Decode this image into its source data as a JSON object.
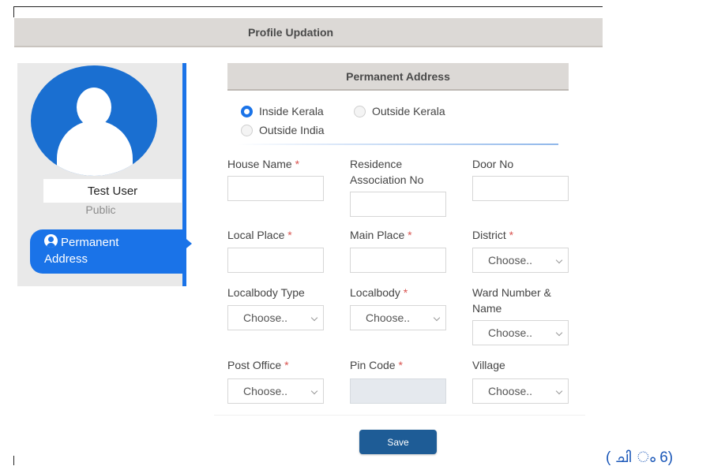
{
  "header": {
    "title": "Profile Updation"
  },
  "profile": {
    "name": "Test User",
    "role": "Public"
  },
  "sidebar": {
    "items": [
      {
        "label_line1": "Permanent",
        "label_line2": "Address"
      }
    ]
  },
  "section": {
    "title": "Permanent Address"
  },
  "location_options": [
    {
      "label": "Inside Kerala",
      "selected": true
    },
    {
      "label": "Outside Kerala",
      "selected": false
    },
    {
      "label": "Outside India",
      "selected": false
    }
  ],
  "fields": {
    "house_name": {
      "label": "House Name",
      "required_mark": "*"
    },
    "residence_assoc": {
      "label_line1": "Residence",
      "label_line2": "Association No"
    },
    "door_no": {
      "label": "Door No"
    },
    "local_place": {
      "label": "Local Place",
      "required_mark": "*"
    },
    "main_place": {
      "label": "Main Place",
      "required_mark": "*"
    },
    "district": {
      "label": "District",
      "required_mark": "*",
      "value": "Choose.."
    },
    "localbody_type": {
      "label": "Localbody Type",
      "value": "Choose.."
    },
    "localbody": {
      "label": "Localbody",
      "required_mark": "*",
      "value": "Choose.."
    },
    "ward": {
      "label_line1": "Ward Number &",
      "label_line2": "Name",
      "value": "Choose.."
    },
    "post_office": {
      "label": "Post Office",
      "required_mark": "*",
      "value": "Choose.."
    },
    "pin_code": {
      "label": "Pin Code",
      "required_mark": "*"
    },
    "village": {
      "label": "Village",
      "value": "Choose.."
    }
  },
  "actions": {
    "save_label": "Save"
  },
  "caption": {
    "text": "( ചി  ം 6)"
  },
  "colors": {
    "accent": "#1a73e8",
    "button": "#1e5c96",
    "header_bg": "#dcd9d6",
    "required": "#d9534f"
  }
}
